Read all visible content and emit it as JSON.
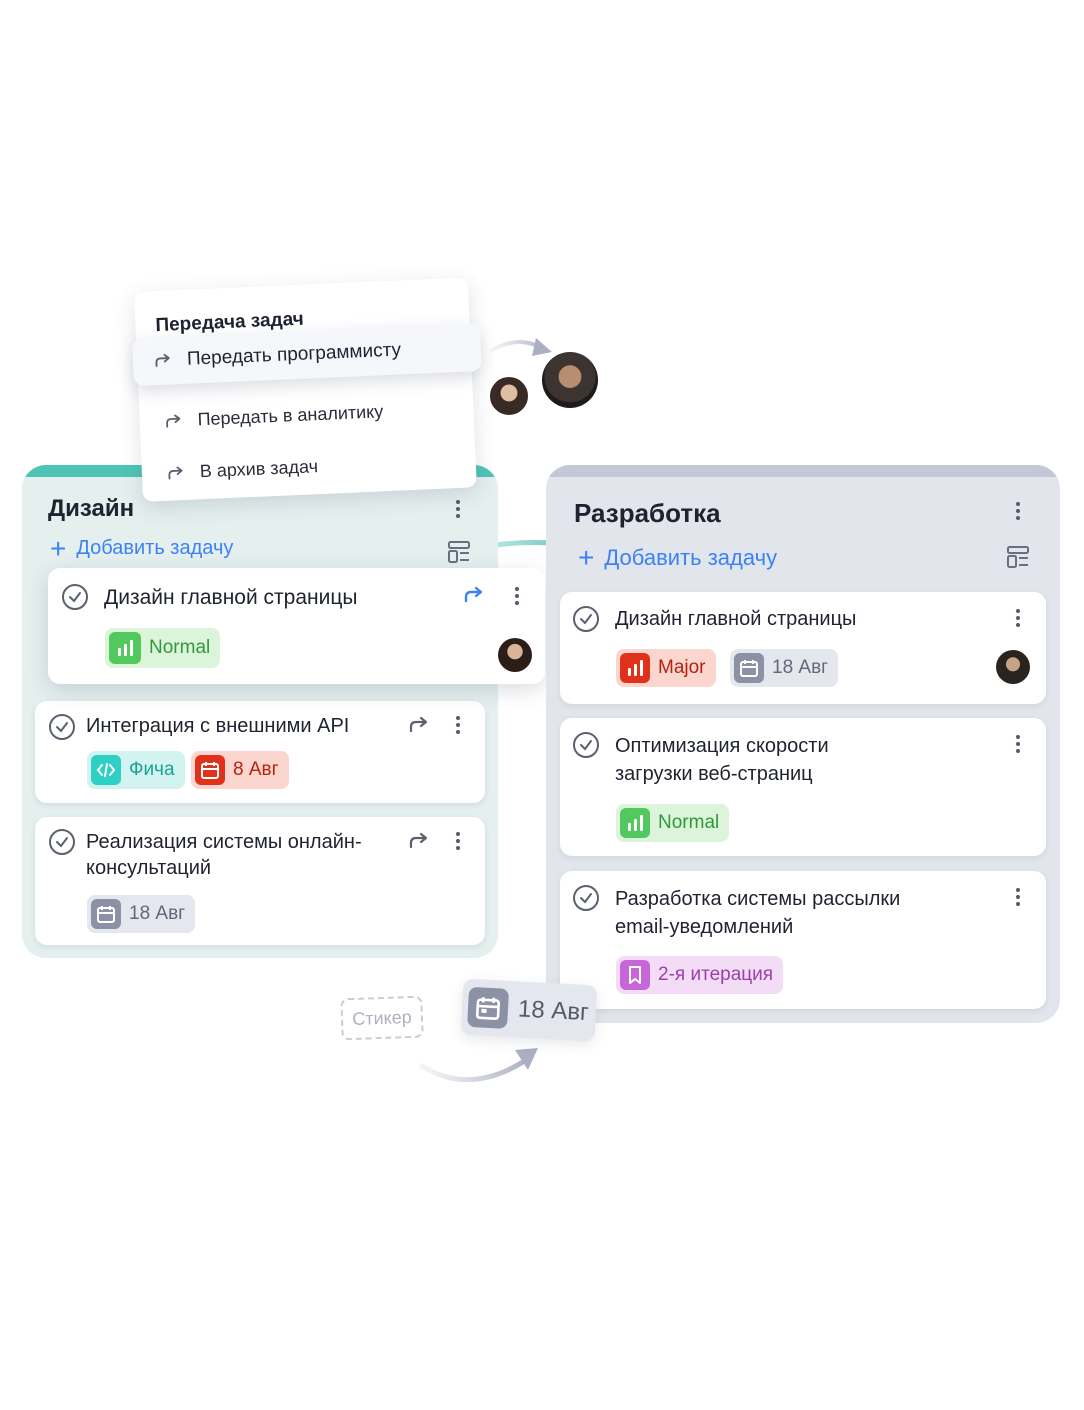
{
  "menu": {
    "title": "Передача задач",
    "items": [
      {
        "label": "Передать программисту",
        "icon": "share-arrow-icon"
      },
      {
        "label": "Передать в аналитику",
        "icon": "share-arrow-icon"
      },
      {
        "label": "В архив задач",
        "icon": "share-arrow-icon"
      }
    ]
  },
  "columns": {
    "design": {
      "title": "Дизайн",
      "add_task": "Добавить задачу",
      "cards": [
        {
          "title": "Дизайн главной страницы",
          "tags": [
            {
              "label": "Normal",
              "kind": "priority-normal"
            }
          ]
        },
        {
          "title": "Интеграция с внешними API",
          "tags": [
            {
              "label": "Фича",
              "kind": "feature"
            },
            {
              "label": "8 Авг",
              "kind": "date-overdue"
            }
          ]
        },
        {
          "title_line1": "Реализация системы онлайн-",
          "title_line2": "консультаций",
          "tags": [
            {
              "label": "18 Авг",
              "kind": "date"
            }
          ]
        }
      ]
    },
    "dev": {
      "title": "Разработка",
      "add_task": "Добавить задачу",
      "cards": [
        {
          "title": "Дизайн главной страницы",
          "tags": [
            {
              "label": "Major",
              "kind": "priority-major"
            },
            {
              "label": "18 Авг",
              "kind": "date"
            }
          ]
        },
        {
          "title_line1": "Оптимизация скорости",
          "title_line2": "загрузки веб-страниц",
          "tags": [
            {
              "label": "Normal",
              "kind": "priority-normal"
            }
          ]
        },
        {
          "title_line1": "Разработка системы рассылки",
          "title_line2": "email-уведомлений",
          "tags": [
            {
              "label": "2-я итерация",
              "kind": "iteration"
            }
          ]
        }
      ]
    }
  },
  "sticker": {
    "label": "Стикер"
  },
  "big_date": {
    "label": "18 Авг"
  },
  "colors": {
    "accent_blue": "#3b82f6",
    "design_column": "#e4efee",
    "design_stripe": "#4fc4b6",
    "dev_column": "#e3e5ec",
    "normal_green": "#52c95e",
    "major_red": "#e0321a",
    "feature_teal": "#2dd0c2",
    "iteration_purple": "#c766d8"
  }
}
